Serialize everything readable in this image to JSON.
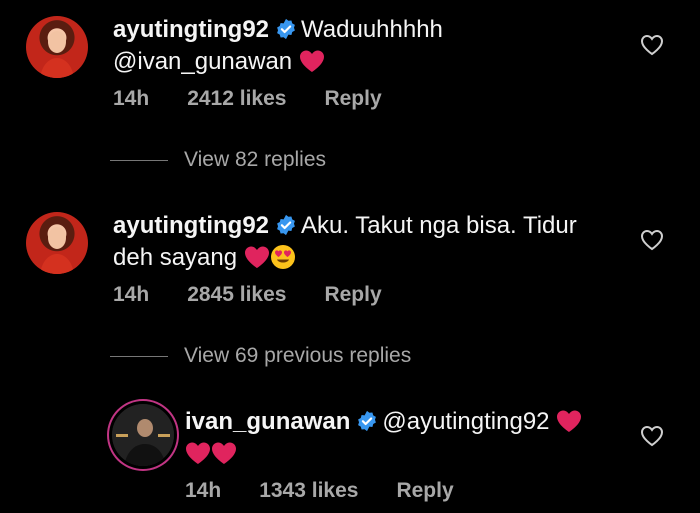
{
  "comments": [
    {
      "username": "ayutingting92",
      "text_line1": "Waduuhhhhh",
      "text_line2": "@ivan_gunawan",
      "time": "14h",
      "likes": "2412 likes",
      "reply": "Reply"
    },
    {
      "username": "ayutingting92",
      "text_line1": "Aku. Takut nga bisa. Tidur",
      "text_line2": "deh sayang",
      "time": "14h",
      "likes": "2845 likes",
      "reply": "Reply"
    },
    {
      "username": "ivan_gunawan",
      "text_line1": "@ayutingting92",
      "time": "14h",
      "likes": "1343 likes",
      "reply": "Reply"
    }
  ],
  "view_replies_1": "View 82 replies",
  "view_replies_2": "View 69 previous replies",
  "icons": {
    "verified": "verified-badge-icon",
    "heart": "red-heart-emoji",
    "smiley": "heart-eyes-emoji",
    "like": "heart-outline-icon"
  },
  "colors": {
    "background": "#000000",
    "verified": "#3897f0",
    "heart": "#e0245e",
    "muted": "#a8a8a8"
  }
}
